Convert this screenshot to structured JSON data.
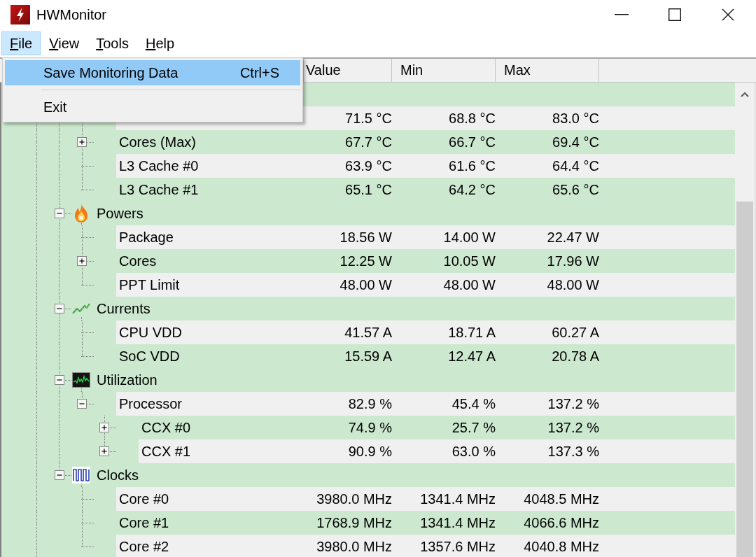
{
  "window": {
    "title": "HWMonitor"
  },
  "menu": [
    {
      "label": "File",
      "selected": true
    },
    {
      "label": "View",
      "selected": false
    },
    {
      "label": "Tools",
      "selected": false
    },
    {
      "label": "Help",
      "selected": false
    }
  ],
  "file_menu": [
    {
      "kind": "item",
      "label": "Save Monitoring Data",
      "shortcut": "Ctrl+S",
      "selected": true
    },
    {
      "kind": "separator"
    },
    {
      "kind": "item",
      "label": "Exit",
      "selected": false
    }
  ],
  "columns": [
    "Value",
    "Min",
    "Max"
  ],
  "groups": [
    {
      "children": [
        {
          "kind": "leaf",
          "value": "71.5 °C",
          "min": "68.8 °C",
          "max": "83.0 °C"
        },
        {
          "kind": "node",
          "expanded": false,
          "label": "Cores (Max)",
          "value": "67.7 °C",
          "min": "66.7 °C",
          "max": "69.4 °C"
        },
        {
          "kind": "leaf",
          "label": "L3 Cache #0",
          "value": "63.9 °C",
          "min": "61.6 °C",
          "max": "64.4 °C"
        },
        {
          "kind": "leaf",
          "label": "L3 Cache #1",
          "value": "65.1 °C",
          "min": "64.2 °C",
          "max": "65.6 °C"
        }
      ]
    },
    {
      "kind": "power",
      "label": "Powers",
      "expanded": true,
      "children": [
        {
          "kind": "leaf",
          "label": "Package",
          "value": "18.56 W",
          "min": "14.00 W",
          "max": "22.47 W"
        },
        {
          "kind": "node",
          "expanded": false,
          "label": "Cores",
          "value": "12.25 W",
          "min": "10.05 W",
          "max": "17.96 W"
        },
        {
          "kind": "leaf",
          "label": "PPT Limit",
          "value": "48.00 W",
          "min": "48.00 W",
          "max": "48.00 W"
        }
      ]
    },
    {
      "kind": "current",
      "label": "Currents",
      "expanded": true,
      "children": [
        {
          "kind": "leaf",
          "label": "CPU VDD",
          "value": "41.57 A",
          "min": "18.71 A",
          "max": "60.27 A"
        },
        {
          "kind": "leaf",
          "label": "SoC VDD",
          "value": "15.59 A",
          "min": "12.47 A",
          "max": "20.78 A"
        }
      ]
    },
    {
      "kind": "utilization",
      "label": "Utilization",
      "expanded": true,
      "children": [
        {
          "kind": "node",
          "expanded": true,
          "label": "Processor",
          "value": "82.9 %",
          "min": "45.4 %",
          "max": "137.2 %",
          "children": [
            {
              "kind": "node",
              "expanded": false,
              "label": "CCX #0",
              "value": "74.9 %",
              "min": "25.7 %",
              "max": "137.2 %"
            },
            {
              "kind": "node",
              "expanded": false,
              "label": "CCX #1",
              "value": "90.9 %",
              "min": "63.0 %",
              "max": "137.3 %"
            }
          ]
        }
      ]
    },
    {
      "kind": "clock",
      "label": "Clocks",
      "expanded": true,
      "children": [
        {
          "kind": "leaf",
          "label": "Core #0",
          "value": "3980.0 MHz",
          "min": "1341.4 MHz",
          "max": "4048.5 MHz"
        },
        {
          "kind": "leaf",
          "label": "Core #1",
          "value": "1768.9 MHz",
          "min": "1341.4 MHz",
          "max": "4066.6 MHz"
        },
        {
          "kind": "leaf",
          "label": "Core #2",
          "value": "3980.0 MHz",
          "min": "1357.6 MHz",
          "max": "4040.8 MHz"
        }
      ]
    }
  ]
}
